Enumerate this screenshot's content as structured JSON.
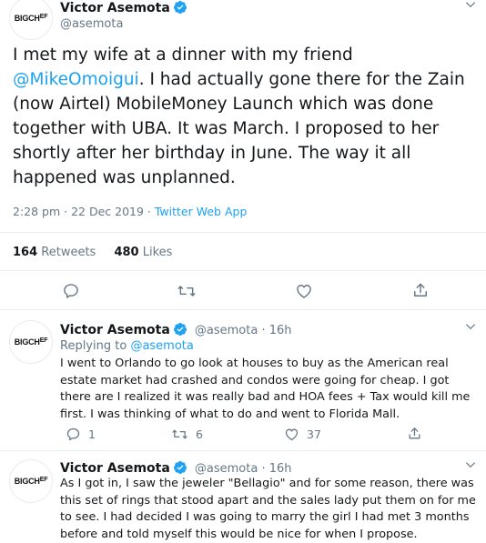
{
  "main_tweet": {
    "avatar_text": "BIGCHEF",
    "name": "Victor Asemota",
    "handle": "@asemota",
    "text_before": "I met my wife at a dinner with my friend ",
    "mention": "@MikeOmoigui",
    "text_after": ". I had actually gone there for the Zain (now Airtel) MobileMoney Launch which was done together with UBA. It was March. I proposed to her shortly after her birthday in June. The way it all happened was unplanned.",
    "timestamp": "2:28 pm · 22 Dec 2019 · ",
    "source": "Twitter Web App",
    "retweets_count": "164",
    "retweets_label": "Retweets",
    "likes_count": "480",
    "likes_label": "Likes"
  },
  "replies": [
    {
      "avatar_text": "BIGCHEF",
      "name": "Victor Asemota",
      "handle": "@asemota",
      "time": " · 16h",
      "replying_label": "Replying to ",
      "replying_handle": "@asemota",
      "text": "I went to Orlando to go look at houses to buy as the American real estate market had crashed and condos were going for cheap. I got there are I realized it was really bad and HOA fees + Tax would kill me first. I was thinking of what to do and went to Florida Mall.",
      "reply_count": "1",
      "retweet_count": "6",
      "like_count": "37"
    },
    {
      "avatar_text": "BIGCHEF",
      "name": "Victor Asemota",
      "handle": "@asemota",
      "time": " · 16h",
      "text": "As I got in, I saw the jeweler \"Bellagio\" and for some reason, there was this set of rings that stood apart and the sales lady put them on for me to see. I had decided I was going to marry the girl I had met 3 months before and told myself this would be nice for when I propose."
    }
  ],
  "colors": {
    "accent": "#1da1f2",
    "secondary_text": "#657786",
    "divider": "#e6ecf0"
  }
}
